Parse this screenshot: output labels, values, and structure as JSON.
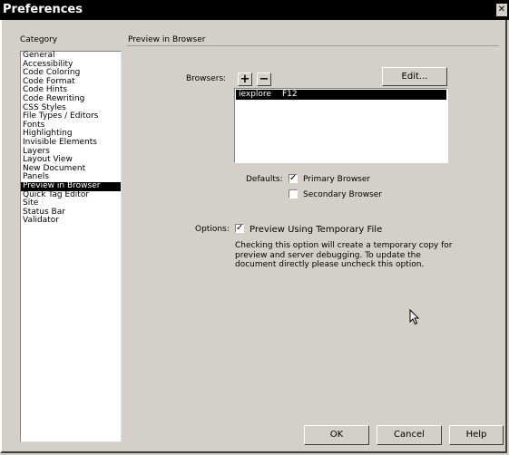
{
  "window": {
    "title": "Preferences",
    "close_glyph": "✕"
  },
  "category": {
    "label": "Category",
    "items": [
      "General",
      "Accessibility",
      "Code Coloring",
      "Code Format",
      "Code Hints",
      "Code Rewriting",
      "CSS Styles",
      "File Types / Editors",
      "Fonts",
      "Highlighting",
      "Invisible Elements",
      "Layers",
      "Layout View",
      "New Document",
      "Panels",
      "Preview in Browser",
      "Quick Tag Editor",
      "Site",
      "Status Bar",
      "Validator"
    ],
    "selected": "Preview in Browser"
  },
  "panel": {
    "heading": "Preview in Browser",
    "browsers_label": "Browsers:",
    "add_label": "+",
    "remove_label": "−",
    "edit_label": "Edit...",
    "browser_entries": [
      {
        "name": "iexplore",
        "key": "F12"
      }
    ],
    "defaults_label": "Defaults:",
    "primary_label": "Primary Browser",
    "primary_checked": true,
    "secondary_label": "Secondary Browser",
    "secondary_checked": false,
    "options_label": "Options:",
    "temp_file_label": "Preview Using Temporary File",
    "temp_file_checked": true,
    "description": "Checking this option will create a temporary copy for preview and server debugging. To update the document directly please uncheck this option."
  },
  "footer": {
    "ok_label": "OK",
    "cancel_label": "Cancel",
    "help_label": "Help"
  },
  "icons": {
    "cursor": "mouse-pointer-icon"
  }
}
